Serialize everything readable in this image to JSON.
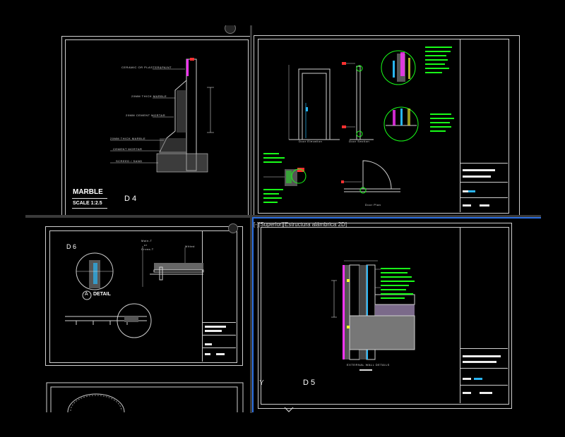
{
  "viewports": {
    "top_left": {
      "notes": [
        "CERAMIC OR PLASTER&PAINT",
        "20MM THICK MARBLE",
        "20MM CEMENT MORTAR",
        "20MM THICK MARBLE",
        "CEMENT MORTAR",
        "SCREED / SAND"
      ],
      "title": "MARBLE",
      "scale": "SCALE 1:2.5",
      "code": "D 4"
    },
    "top_right": {
      "label_elevation": "Door Elevation",
      "label_section": "Door Section",
      "label_plan": "Door Plan"
    },
    "bottom_left": {
      "code": "D 6",
      "detail_label": "DETAIL",
      "detail_marker": "A",
      "notes": [
        "Main-T",
        "or",
        "Cross-T",
        "Mitted"
      ]
    },
    "bottom_right": {
      "viewport_label": "[-][Superior][Estructura alámbrica 2D]",
      "drawing_title": "EXTERNAL WALL DETAILS",
      "code": "D 5",
      "ucs_label": "Y"
    }
  },
  "colors": {
    "background": "#000000",
    "line": "#d0d0d0",
    "green": "#19ff19",
    "magenta": "#ff33ff",
    "cyan": "#29b6f6",
    "red": "#ff3030",
    "yellow": "#ffff33",
    "active_border": "#2a6ee0"
  },
  "icons": [
    "navigation-cube-icon",
    "ucs-icon",
    "chevron-down-icon"
  ]
}
